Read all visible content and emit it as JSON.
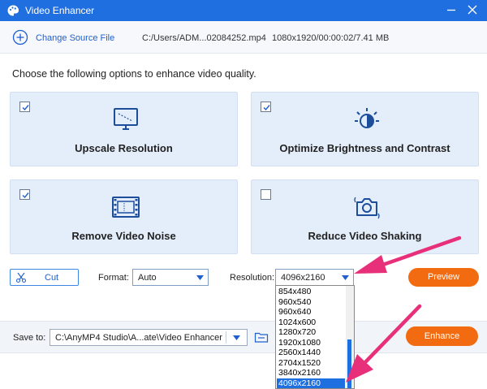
{
  "window": {
    "title": "Video Enhancer"
  },
  "filebar": {
    "change_source_label": "Change Source File",
    "file_path": "C:/Users/ADM...02084252.mp4",
    "file_meta": "1080x1920/00:00:02/7.41 MB"
  },
  "instruction": "Choose the following options to enhance video quality.",
  "options": [
    {
      "label": "Upscale Resolution",
      "checked": true,
      "icon": "monitor-icon"
    },
    {
      "label": "Optimize Brightness and Contrast",
      "checked": true,
      "icon": "brightness-icon"
    },
    {
      "label": "Remove Video Noise",
      "checked": true,
      "icon": "film-icon"
    },
    {
      "label": "Reduce Video Shaking",
      "checked": false,
      "icon": "camera-icon"
    }
  ],
  "controls": {
    "cut_label": "Cut",
    "format_label": "Format:",
    "format_value": "Auto",
    "resolution_label": "Resolution:",
    "resolution_value": "4096x2160",
    "preview_label": "Preview"
  },
  "resolution_options": [
    "854x480",
    "960x540",
    "960x640",
    "1024x600",
    "1280x720",
    "1920x1080",
    "2560x1440",
    "2704x1520",
    "3840x2160",
    "4096x2160"
  ],
  "resolution_selected": "4096x2160",
  "save": {
    "label": "Save to:",
    "path": "C:\\AnyMP4 Studio\\A...ate\\Video Enhancer",
    "enhance_label": "Enhance"
  },
  "colors": {
    "titlebar": "#1f6fe0",
    "accent_button": "#f26b10",
    "option_card": "#e4eefb",
    "annotation_arrow": "#e8307a"
  }
}
